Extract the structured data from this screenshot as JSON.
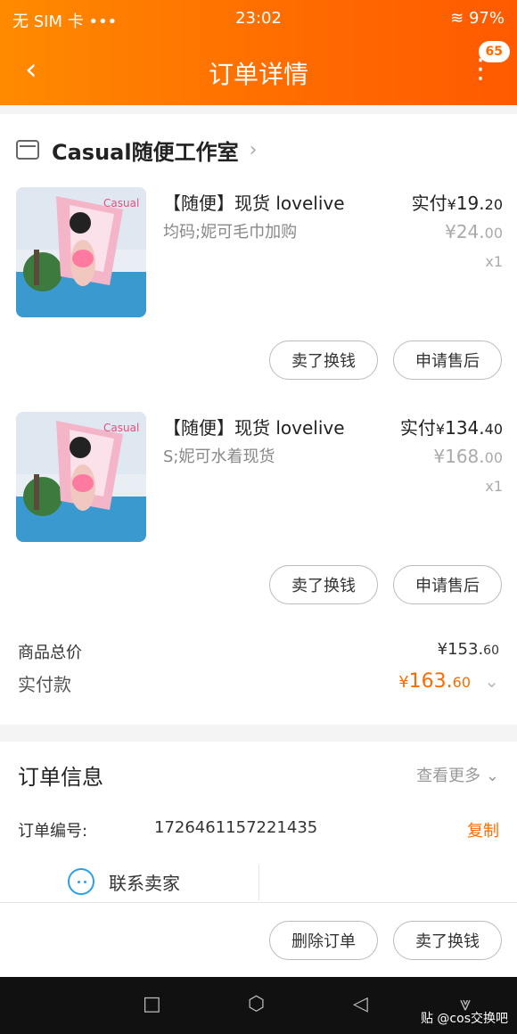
{
  "status": {
    "carrier": "无 SIM 卡 •••",
    "time": "23:02",
    "battery": "97%"
  },
  "header": {
    "title": "订单详情",
    "badge": "65"
  },
  "shop": {
    "name": "Casual随便工作室"
  },
  "items": [
    {
      "title": "【随便】现货 lovelive",
      "spec": "均码;妮可毛巾加购",
      "paid_label": "实付",
      "paid_int": "19.",
      "paid_dec": "20",
      "orig_int": "24.",
      "orig_dec": "00",
      "qty": "x1",
      "btn_sell": "卖了换钱",
      "btn_after": "申请售后"
    },
    {
      "title": "【随便】现货 lovelive",
      "spec": "S;妮可水着现货",
      "paid_label": "实付",
      "paid_int": "134.",
      "paid_dec": "40",
      "orig_int": "168.",
      "orig_dec": "00",
      "qty": "x1",
      "btn_sell": "卖了换钱",
      "btn_after": "申请售后"
    }
  ],
  "summary": {
    "total_label": "商品总价",
    "total_int": "153.",
    "total_dec": "60",
    "paid_label": "实付款",
    "paid_int": "163.",
    "paid_dec": "60"
  },
  "order_info": {
    "title": "订单信息",
    "see_more": "查看更多",
    "order_no_label": "订单编号:",
    "order_no": "1726461157221435",
    "copy": "复制",
    "contact": "联系卖家"
  },
  "actions": {
    "delete": "删除订单",
    "sell": "卖了换钱"
  },
  "watermark": "贴 @cos交换吧",
  "colors": {
    "accent": "#ff6a00",
    "header_gradient_start": "#ff8a00"
  }
}
